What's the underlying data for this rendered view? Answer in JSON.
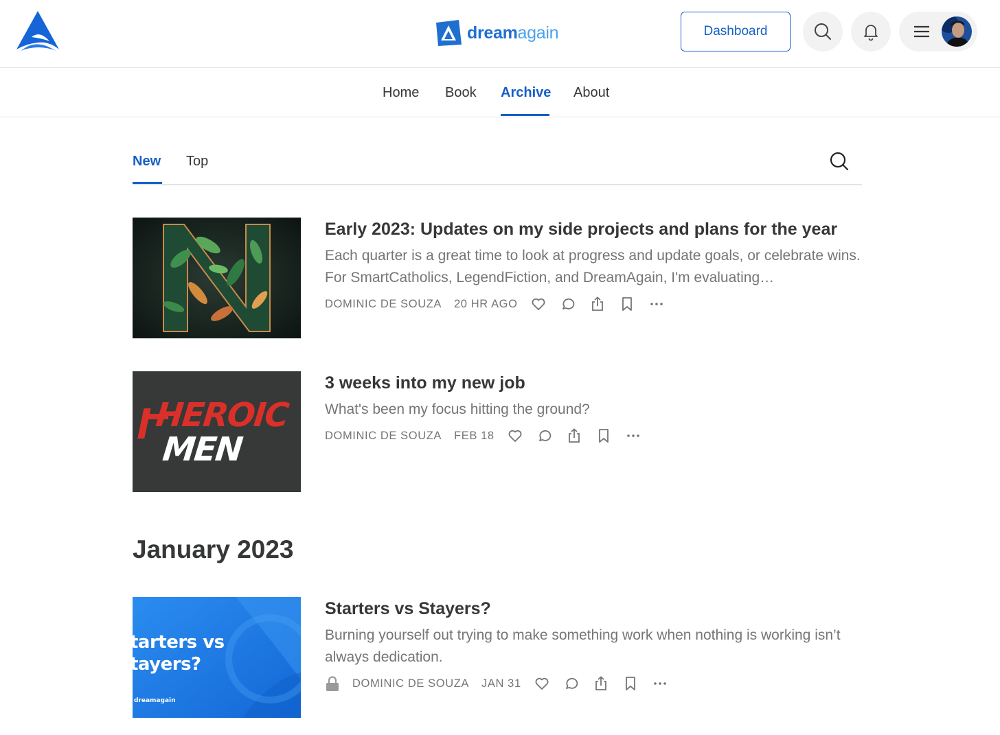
{
  "header": {
    "brand_main": "dream",
    "brand_accent": "again",
    "dashboard_label": "Dashboard"
  },
  "nav": {
    "items": [
      {
        "label": "Home"
      },
      {
        "label": "Book"
      },
      {
        "label": "Archive"
      },
      {
        "label": "About"
      }
    ],
    "active": "Archive"
  },
  "tabs": {
    "items": [
      {
        "label": "New"
      },
      {
        "label": "Top"
      }
    ],
    "active": "New"
  },
  "posts": [
    {
      "title": "Early 2023: Updates on my side projects and plans for the year",
      "subtitle": "Each quarter is a great time to look at progress and update goals, or celebrate wins. For SmartCatholics, LegendFiction, and DreamAgain, I'm evaluating…",
      "author": "DOMINIC DE SOUZA",
      "date": "20 HR AGO",
      "locked": false,
      "thumb_letter": "N"
    },
    {
      "title": "3 weeks into my new job",
      "subtitle": "What's been my focus hitting the ground?",
      "author": "DOMINIC DE SOUZA",
      "date": "FEB 18",
      "locked": false,
      "thumb_line1": "HEROIC",
      "thumb_line2": "MEN"
    },
    {
      "title": "Starters vs Stayers?",
      "subtitle": "Burning yourself out trying to make something work when nothing is working isn’t always dedication.",
      "author": "DOMINIC DE SOUZA",
      "date": "JAN 31",
      "locked": true,
      "thumb_line1": "tarters vs",
      "thumb_line2": "tayers?",
      "thumb_brand": "dreamagain"
    }
  ],
  "month_heading": "January 2023",
  "colors": {
    "accent": "#1560c6",
    "text": "#363737",
    "muted": "#757575"
  },
  "icons": [
    "site-logo-icon",
    "search-icon",
    "bell-icon",
    "hamburger-icon",
    "heart-icon",
    "comment-icon",
    "share-icon",
    "bookmark-icon",
    "more-icon",
    "lock-icon"
  ]
}
